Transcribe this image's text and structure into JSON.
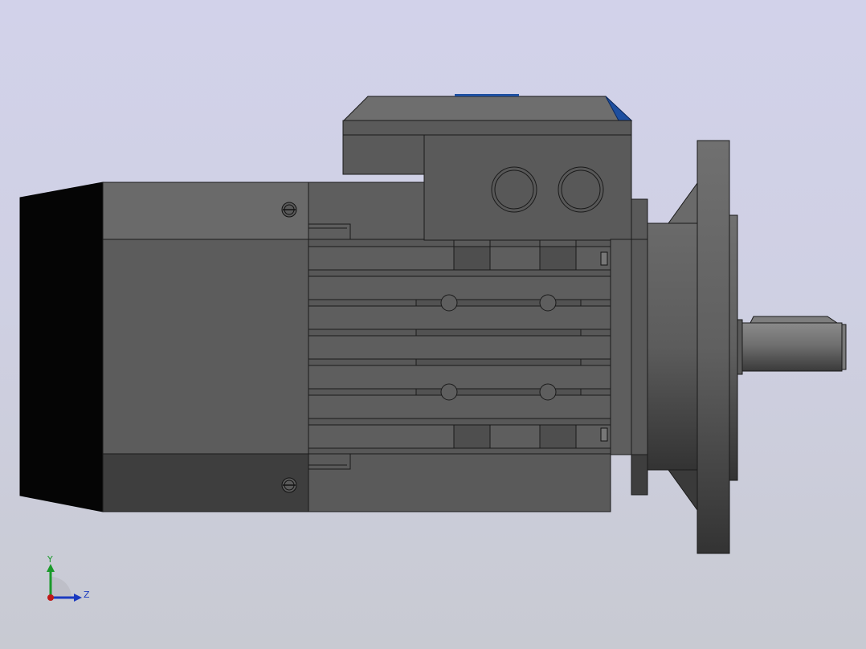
{
  "viewport": {
    "background_top": "#d2d2ea",
    "background_bottom": "#c8cad2"
  },
  "model": {
    "body_color": "#5a5a5a",
    "accent_color": "#1e4fa0",
    "fan_cover_color": "#050505"
  },
  "triad": {
    "y_label": "Y",
    "z_label": "Z",
    "y_color": "#1a9a2a",
    "z_color": "#1a3ac0",
    "x_color": "#c01818"
  }
}
